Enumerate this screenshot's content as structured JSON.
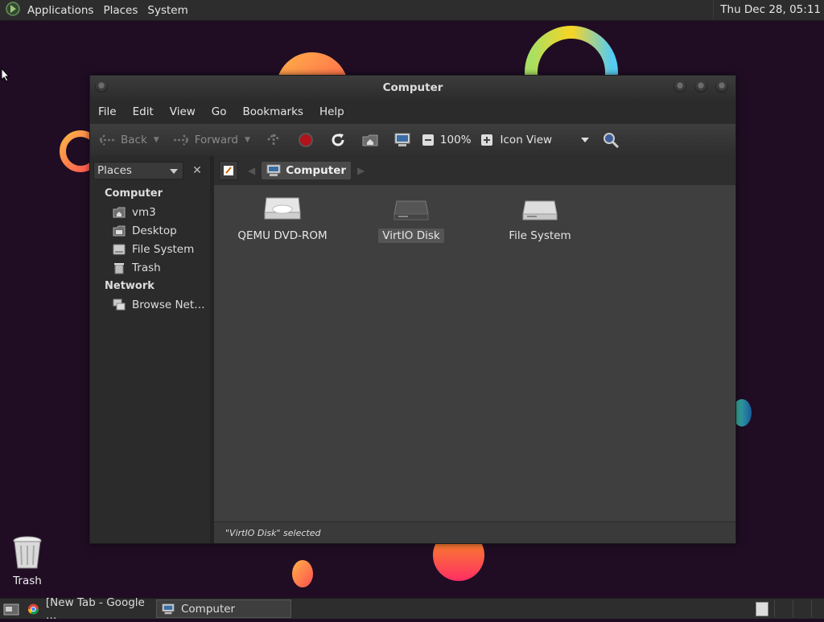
{
  "top_panel": {
    "menus": [
      "Applications",
      "Places",
      "System"
    ],
    "clock": "Thu Dec 28, 05:11"
  },
  "window": {
    "title": "Computer",
    "menus": [
      "File",
      "Edit",
      "View",
      "Go",
      "Bookmarks",
      "Help"
    ],
    "toolbar": {
      "back": "Back",
      "forward": "Forward",
      "zoom": "100%",
      "view_mode": "Icon View"
    },
    "sidebar": {
      "selector": "Places",
      "sections": [
        {
          "title": "Computer",
          "items": [
            "vm3",
            "Desktop",
            "File System",
            "Trash"
          ]
        },
        {
          "title": "Network",
          "items": [
            "Browse Net…"
          ]
        }
      ]
    },
    "location": {
      "crumb": "Computer"
    },
    "files": [
      {
        "name": "QEMU DVD-ROM",
        "icon": "optical-drive-icon",
        "selected": false
      },
      {
        "name": "VirtIO Disk",
        "icon": "hard-disk-icon",
        "selected": true
      },
      {
        "name": "File System",
        "icon": "hard-disk-icon",
        "selected": false
      }
    ],
    "status": "\"VirtIO Disk\" selected"
  },
  "desktop": {
    "trash_label": "Trash"
  },
  "bottom_panel": {
    "tasks": [
      {
        "label": "[New Tab - Google …",
        "icon": "chrome-icon",
        "active": false
      },
      {
        "label": "Computer",
        "icon": "computer-icon",
        "active": true
      }
    ]
  }
}
